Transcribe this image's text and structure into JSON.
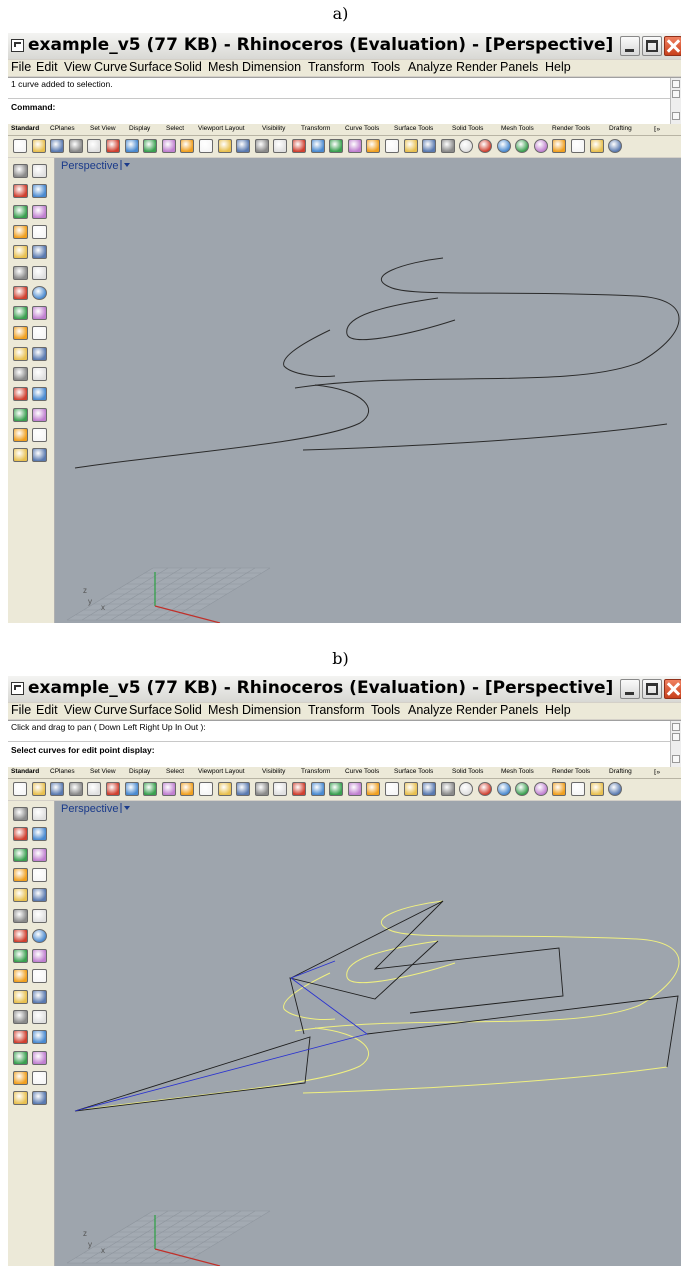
{
  "panel_a": {
    "caption": "a)",
    "title": "example_v5 (77 KB) - Rhinoceros (Evaluation) - [Perspective]",
    "menu": [
      "File",
      "Edit",
      "View",
      "Curve",
      "Surface",
      "Solid",
      "Mesh",
      "Dimension",
      "Transform",
      "Tools",
      "Analyze",
      "Render",
      "Panels",
      "Help"
    ],
    "history_line": "1 curve added to selection.",
    "command_line": "Command:",
    "tabs": [
      "Standard",
      "CPlanes",
      "Set View",
      "Display",
      "Select",
      "Viewport Layout",
      "Visibility",
      "Transform",
      "Curve Tools",
      "Surface Tools",
      "Solid Tools",
      "Mesh Tools",
      "Render Tools",
      "Drafting",
      "⁅»"
    ],
    "viewport_title": "Perspective",
    "axis_labels": {
      "z": "z",
      "y": "y",
      "x": "x"
    }
  },
  "panel_b": {
    "caption": "b)",
    "title": "example_v5 (77 KB) - Rhinoceros (Evaluation) - [Perspective]",
    "menu": [
      "File",
      "Edit",
      "View",
      "Curve",
      "Surface",
      "Solid",
      "Mesh",
      "Dimension",
      "Transform",
      "Tools",
      "Analyze",
      "Render",
      "Panels",
      "Help"
    ],
    "history_line": "Click and drag to pan ( Down  Left  Right  Up  In  Out ):",
    "command_line": "Select curves for edit point display:",
    "tabs": [
      "Standard",
      "CPlanes",
      "Set View",
      "Display",
      "Select",
      "Viewport Layout",
      "Visibility",
      "Transform",
      "Curve Tools",
      "Surface Tools",
      "Solid Tools",
      "Mesh Tools",
      "Render Tools",
      "Drafting",
      "⁅»"
    ],
    "viewport_title": "Perspective",
    "axis_labels": {
      "z": "z",
      "y": "y",
      "x": "x"
    }
  },
  "colors": {
    "viewport_bg": "#9ea5ad",
    "curve": "#2a2a2a",
    "selected_curve": "#f0f080",
    "control_polygon": "#1e1e1e",
    "control_polygon_highlight": "#2a32d0",
    "grid": "#8e959d",
    "x_axis": "#c0302a",
    "y_axis": "#2aa040",
    "title_text": "#000000",
    "viewport_title": "#1a3a8a"
  },
  "toolbar_icons": [
    "new-icon",
    "open-icon",
    "save-icon",
    "print-icon",
    "template-icon",
    "cut-icon",
    "copy-icon",
    "paste-icon",
    "undo-icon",
    "pan-hand-icon",
    "rotate-view-icon",
    "zoom-icon",
    "zoom-window-icon",
    "zoom-extents-icon",
    "zoom-selected-icon",
    "undo-view-icon",
    "four-viewports-icon",
    "car-render-icon",
    "shade-icon",
    "orbit-icon",
    "snap-icon",
    "light-icon",
    "lock-icon",
    "layer-icon",
    "color-wheel-icon",
    "render-sphere-icon",
    "material-sphere-icon",
    "rendered-sphere-icon",
    "ball-icon",
    "pointer-icon",
    "options-icon",
    "grid-snap-icon",
    "help-icon"
  ],
  "sidebar_icons": [
    "select-icon",
    "point-icon",
    "polyline-icon",
    "control-curve-icon",
    "circle-icon",
    "ellipse-icon",
    "polygon-icon",
    "rectangle-icon",
    "arc-icon",
    "freeform-curve-icon",
    "fillet-icon",
    "offset-icon",
    "box-icon",
    "sphere-icon",
    "extrude-icon",
    "surface-icon",
    "boolean-icon",
    "mirror-icon",
    "move-icon",
    "rotate-icon",
    "group-icon",
    "array-icon",
    "text-icon",
    "dimension-icon",
    "mesh-icon",
    "hatch-icon",
    "check-icon",
    "analysis-icon",
    "render-icon",
    "paint-icon"
  ]
}
